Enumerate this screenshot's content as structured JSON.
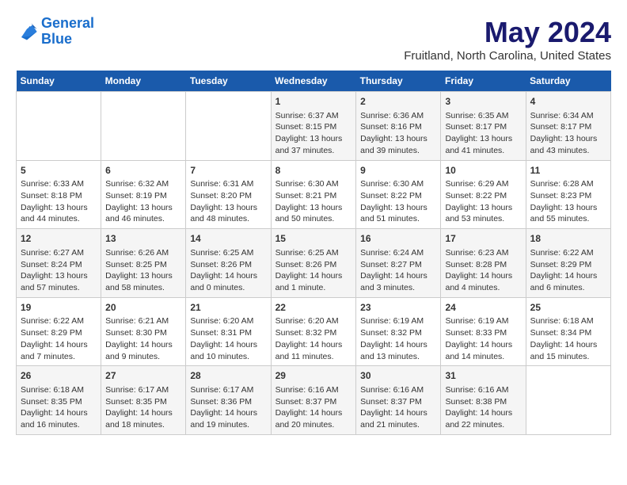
{
  "logo": {
    "line1": "General",
    "line2": "Blue"
  },
  "title": "May 2024",
  "subtitle": "Fruitland, North Carolina, United States",
  "days_of_week": [
    "Sunday",
    "Monday",
    "Tuesday",
    "Wednesday",
    "Thursday",
    "Friday",
    "Saturday"
  ],
  "weeks": [
    [
      {
        "day": "",
        "content": ""
      },
      {
        "day": "",
        "content": ""
      },
      {
        "day": "",
        "content": ""
      },
      {
        "day": "1",
        "content": "Sunrise: 6:37 AM\nSunset: 8:15 PM\nDaylight: 13 hours and 37 minutes."
      },
      {
        "day": "2",
        "content": "Sunrise: 6:36 AM\nSunset: 8:16 PM\nDaylight: 13 hours and 39 minutes."
      },
      {
        "day": "3",
        "content": "Sunrise: 6:35 AM\nSunset: 8:17 PM\nDaylight: 13 hours and 41 minutes."
      },
      {
        "day": "4",
        "content": "Sunrise: 6:34 AM\nSunset: 8:17 PM\nDaylight: 13 hours and 43 minutes."
      }
    ],
    [
      {
        "day": "5",
        "content": "Sunrise: 6:33 AM\nSunset: 8:18 PM\nDaylight: 13 hours and 44 minutes."
      },
      {
        "day": "6",
        "content": "Sunrise: 6:32 AM\nSunset: 8:19 PM\nDaylight: 13 hours and 46 minutes."
      },
      {
        "day": "7",
        "content": "Sunrise: 6:31 AM\nSunset: 8:20 PM\nDaylight: 13 hours and 48 minutes."
      },
      {
        "day": "8",
        "content": "Sunrise: 6:30 AM\nSunset: 8:21 PM\nDaylight: 13 hours and 50 minutes."
      },
      {
        "day": "9",
        "content": "Sunrise: 6:30 AM\nSunset: 8:22 PM\nDaylight: 13 hours and 51 minutes."
      },
      {
        "day": "10",
        "content": "Sunrise: 6:29 AM\nSunset: 8:22 PM\nDaylight: 13 hours and 53 minutes."
      },
      {
        "day": "11",
        "content": "Sunrise: 6:28 AM\nSunset: 8:23 PM\nDaylight: 13 hours and 55 minutes."
      }
    ],
    [
      {
        "day": "12",
        "content": "Sunrise: 6:27 AM\nSunset: 8:24 PM\nDaylight: 13 hours and 57 minutes."
      },
      {
        "day": "13",
        "content": "Sunrise: 6:26 AM\nSunset: 8:25 PM\nDaylight: 13 hours and 58 minutes."
      },
      {
        "day": "14",
        "content": "Sunrise: 6:25 AM\nSunset: 8:26 PM\nDaylight: 14 hours and 0 minutes."
      },
      {
        "day": "15",
        "content": "Sunrise: 6:25 AM\nSunset: 8:26 PM\nDaylight: 14 hours and 1 minute."
      },
      {
        "day": "16",
        "content": "Sunrise: 6:24 AM\nSunset: 8:27 PM\nDaylight: 14 hours and 3 minutes."
      },
      {
        "day": "17",
        "content": "Sunrise: 6:23 AM\nSunset: 8:28 PM\nDaylight: 14 hours and 4 minutes."
      },
      {
        "day": "18",
        "content": "Sunrise: 6:22 AM\nSunset: 8:29 PM\nDaylight: 14 hours and 6 minutes."
      }
    ],
    [
      {
        "day": "19",
        "content": "Sunrise: 6:22 AM\nSunset: 8:29 PM\nDaylight: 14 hours and 7 minutes."
      },
      {
        "day": "20",
        "content": "Sunrise: 6:21 AM\nSunset: 8:30 PM\nDaylight: 14 hours and 9 minutes."
      },
      {
        "day": "21",
        "content": "Sunrise: 6:20 AM\nSunset: 8:31 PM\nDaylight: 14 hours and 10 minutes."
      },
      {
        "day": "22",
        "content": "Sunrise: 6:20 AM\nSunset: 8:32 PM\nDaylight: 14 hours and 11 minutes."
      },
      {
        "day": "23",
        "content": "Sunrise: 6:19 AM\nSunset: 8:32 PM\nDaylight: 14 hours and 13 minutes."
      },
      {
        "day": "24",
        "content": "Sunrise: 6:19 AM\nSunset: 8:33 PM\nDaylight: 14 hours and 14 minutes."
      },
      {
        "day": "25",
        "content": "Sunrise: 6:18 AM\nSunset: 8:34 PM\nDaylight: 14 hours and 15 minutes."
      }
    ],
    [
      {
        "day": "26",
        "content": "Sunrise: 6:18 AM\nSunset: 8:35 PM\nDaylight: 14 hours and 16 minutes."
      },
      {
        "day": "27",
        "content": "Sunrise: 6:17 AM\nSunset: 8:35 PM\nDaylight: 14 hours and 18 minutes."
      },
      {
        "day": "28",
        "content": "Sunrise: 6:17 AM\nSunset: 8:36 PM\nDaylight: 14 hours and 19 minutes."
      },
      {
        "day": "29",
        "content": "Sunrise: 6:16 AM\nSunset: 8:37 PM\nDaylight: 14 hours and 20 minutes."
      },
      {
        "day": "30",
        "content": "Sunrise: 6:16 AM\nSunset: 8:37 PM\nDaylight: 14 hours and 21 minutes."
      },
      {
        "day": "31",
        "content": "Sunrise: 6:16 AM\nSunset: 8:38 PM\nDaylight: 14 hours and 22 minutes."
      },
      {
        "day": "",
        "content": ""
      }
    ]
  ]
}
